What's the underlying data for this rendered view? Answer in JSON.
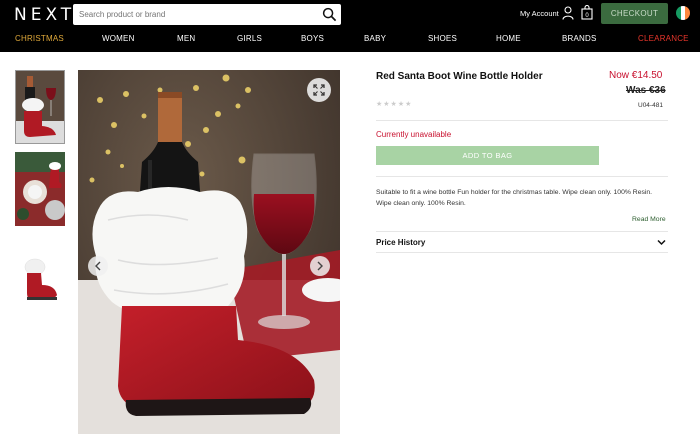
{
  "brand": {
    "logo": "NEXT"
  },
  "search": {
    "placeholder": "Search product or brand",
    "icon": "search-icon"
  },
  "header": {
    "account_label": "My Account",
    "checkout_label": "CHECKOUT",
    "flag_colors": [
      "#169b62",
      "#ffffff",
      "#ff883e"
    ]
  },
  "nav": {
    "items": [
      {
        "label": "CHRISTMAS"
      },
      {
        "label": "WOMEN"
      },
      {
        "label": "MEN"
      },
      {
        "label": "GIRLS"
      },
      {
        "label": "BOYS"
      },
      {
        "label": "BABY"
      },
      {
        "label": "SHOES"
      },
      {
        "label": "HOME"
      },
      {
        "label": "BRANDS"
      },
      {
        "label": "CLEARANCE"
      }
    ],
    "christmas_color": "#e0a93a",
    "clearance_color": "#e8362b"
  },
  "product": {
    "title": "Red Santa Boot Wine Bottle Holder",
    "price_now": "Now €14.50",
    "price_was": "Was €36",
    "code": "U04-481",
    "rating_stars": "★★★★★",
    "availability": "Currently unavailable",
    "add_to_bag": "ADD TO BAG",
    "description": "Suitable to fit a wine bottle Fun holder for the christmas table. Wipe clean only. 100% Resin. Wipe clean only. 100% Resin.",
    "read_more": "Read More",
    "price_history": "Price History"
  },
  "colors": {
    "accent_red": "#c8102e",
    "checkout_green": "#3b6b3f",
    "add_bag_green": "#a8d3a4"
  }
}
